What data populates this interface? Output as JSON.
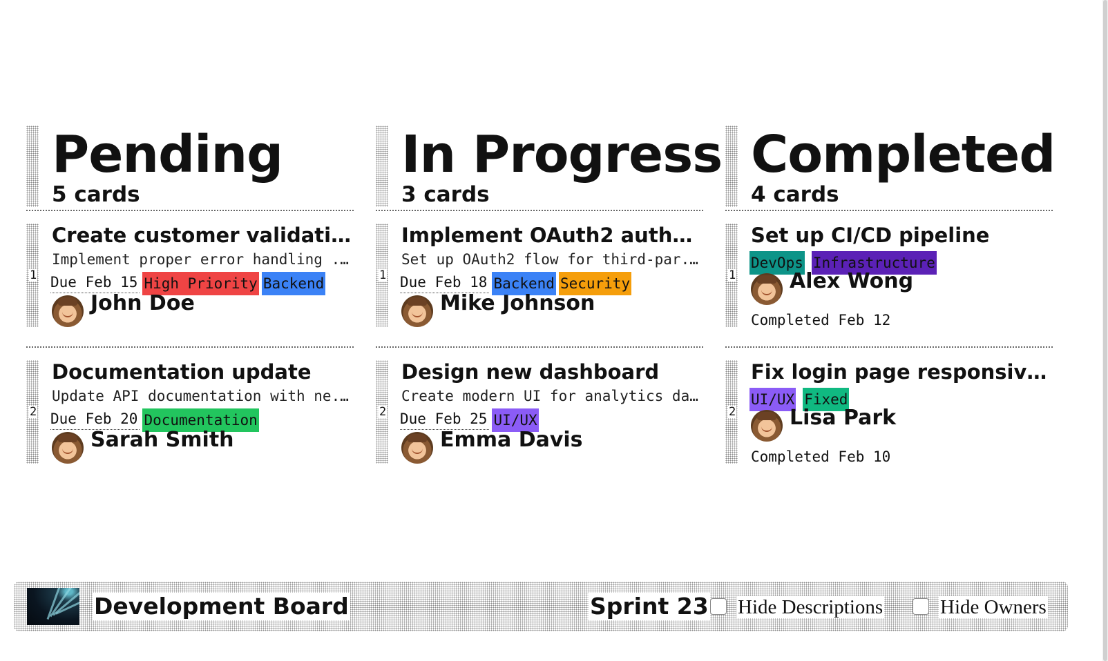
{
  "board": {
    "columns": [
      {
        "title": "Pending",
        "count": "5 cards",
        "cards": [
          {
            "num": "1",
            "title": "Create customer validati...",
            "desc": "Implement proper error handling ...",
            "due": "Due Feb 15",
            "tags": [
              {
                "label": "High Priority",
                "color": "#ef4444"
              },
              {
                "label": "Backend",
                "color": "#3b82f6"
              }
            ],
            "owner": "John Doe"
          },
          {
            "num": "2",
            "title": "Documentation update",
            "desc": "Update API documentation with ne...",
            "due": "Due Feb 20",
            "tags": [
              {
                "label": "Documentation",
                "color": "#22c55e"
              }
            ],
            "owner": "Sarah Smith"
          }
        ]
      },
      {
        "title": "In Progress",
        "count": "3 cards",
        "cards": [
          {
            "num": "1",
            "title": "Implement OAuth2 authe...",
            "desc": "Set up OAuth2 flow for third-par...",
            "due": "Due Feb 18",
            "tags": [
              {
                "label": "Backend",
                "color": "#3b82f6"
              },
              {
                "label": "Security",
                "color": "#f59e0b"
              }
            ],
            "owner": "Mike Johnson"
          },
          {
            "num": "2",
            "title": "Design new dashboard",
            "desc": "Create modern UI for analytics da...",
            "due": "Due Feb 25",
            "tags": [
              {
                "label": "UI/UX",
                "color": "#8b5cf6"
              }
            ],
            "owner": "Emma Davis"
          }
        ]
      },
      {
        "title": "Completed",
        "count": "4 cards",
        "cards": [
          {
            "num": "1",
            "title": "Set up CI/CD pipeline",
            "tags": [
              {
                "label": "DevOps",
                "color": "#0d9488"
              },
              {
                "label": "Infrastructure",
                "color": "#5b21b6"
              }
            ],
            "owner": "Alex Wong",
            "completed": "Completed Feb 12"
          },
          {
            "num": "2",
            "title": "Fix login page responsive...",
            "tags": [
              {
                "label": "UI/UX",
                "color": "#8b5cf6"
              },
              {
                "label": "Fixed",
                "color": "#10b981"
              }
            ],
            "owner": "Lisa Park",
            "completed": "Completed Feb 10"
          }
        ]
      }
    ]
  },
  "footer": {
    "title": "Development Board",
    "sprint": "Sprint 23",
    "hide_descriptions": "Hide Descriptions",
    "hide_owners": "Hide Owners",
    "logo_icon": "spiral-logo-icon"
  }
}
